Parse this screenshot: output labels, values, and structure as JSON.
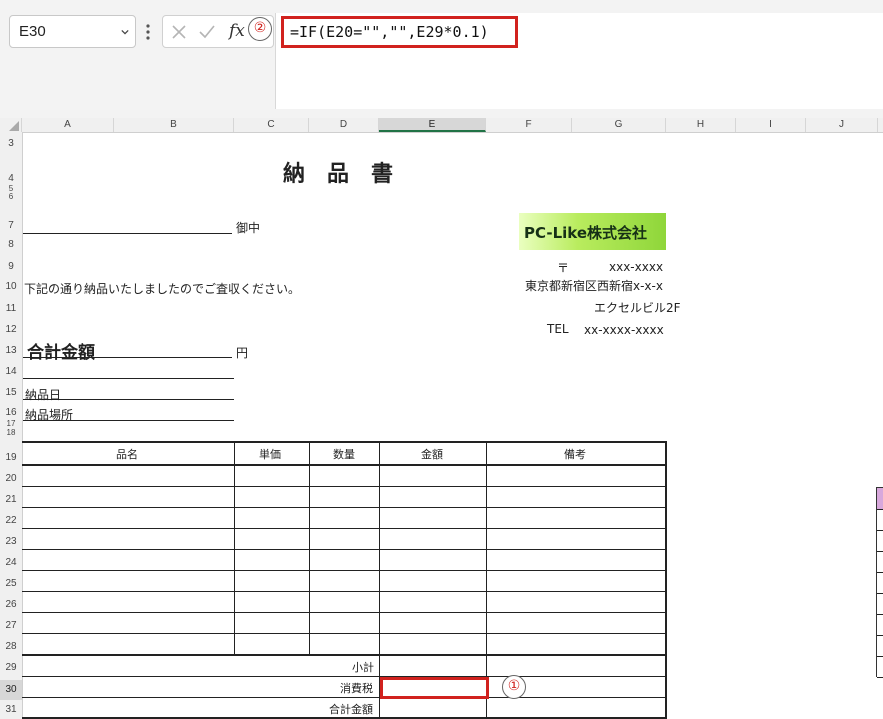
{
  "formula_bar": {
    "name_box": "E30",
    "fx_label": "fx",
    "formula": "=IF(E20=\"\",\"\",E29*0.1)",
    "callout_formula": "②",
    "callout_cell": "①"
  },
  "columns": [
    "A",
    "B",
    "C",
    "D",
    "E",
    "F",
    "G",
    "H",
    "I",
    "J"
  ],
  "rows": [
    "3",
    "4",
    "5",
    "6",
    "7",
    "8",
    "9",
    "10",
    "11",
    "12",
    "13",
    "14",
    "15",
    "16",
    "17",
    "18",
    "19",
    "20",
    "21",
    "22",
    "23",
    "24",
    "25",
    "26",
    "27",
    "28",
    "29",
    "30",
    "31"
  ],
  "document": {
    "title": "納　品　書",
    "honorific": "御中",
    "company_logo": "PC-Like株式会社",
    "postal_mark": "〒",
    "postal_code": "xxx-xxxx",
    "address1": "東京都新宿区西新宿x-x-x",
    "address2": "エクセルビル2F",
    "tel_label": "TEL",
    "tel": "xx-xxxx-xxxx",
    "intro": "下記の通り納品いたしましたのでご査収ください。",
    "total_label": "合計金額",
    "yen": "円",
    "delivery_date_label": "納品日",
    "delivery_place_label": "納品場所"
  },
  "table": {
    "headers": [
      "品名",
      "単価",
      "数量",
      "金額",
      "備考"
    ],
    "subtotal_label": "小計",
    "tax_label": "消費税",
    "grand_total_label": "合計金額"
  },
  "colors": {
    "accent_red": "#d1221e",
    "excel_green": "#217346",
    "logo_green": "#b9ec5e"
  }
}
